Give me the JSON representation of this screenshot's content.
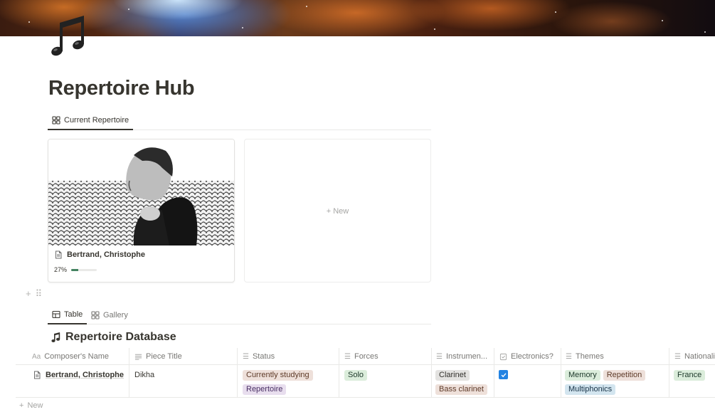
{
  "page": {
    "title": "Repertoire Hub",
    "icon": "musical-notes-icon"
  },
  "top_view": {
    "tabs": [
      {
        "label": "Current Repertoire",
        "icon": "gallery-icon",
        "active": true
      }
    ]
  },
  "gallery": {
    "cards": [
      {
        "title": "Bertrand, Christophe",
        "progress_label": "27%",
        "progress": 0.27,
        "icon": "page-icon"
      }
    ],
    "new_label": "+ New"
  },
  "database": {
    "tabs": [
      {
        "label": "Table",
        "icon": "table-icon",
        "active": true
      },
      {
        "label": "Gallery",
        "icon": "gallery-icon",
        "active": false
      }
    ],
    "title": "Repertoire Database",
    "title_icon": "musical-note-icon",
    "columns": [
      {
        "label": "Composer's Name",
        "icon": "Aa"
      },
      {
        "label": "Piece Title",
        "icon": "text-icon"
      },
      {
        "label": "Status",
        "icon": "list-icon"
      },
      {
        "label": "Forces",
        "icon": "list-icon"
      },
      {
        "label": "Instrumen...",
        "icon": "list-icon"
      },
      {
        "label": "Electronics?",
        "icon": "checkbox-icon"
      },
      {
        "label": "Themes",
        "icon": "list-icon"
      },
      {
        "label": "Nationali",
        "icon": "list-icon"
      }
    ],
    "rows": [
      {
        "composer": "Bertrand, Christophe",
        "piece": "Dikha",
        "status": [
          "Currently studying",
          "Repertoire"
        ],
        "forces": [
          "Solo"
        ],
        "instrumentation": [
          "Clarinet",
          "Bass clarinet"
        ],
        "electronics": true,
        "themes": [
          "Memory",
          "Repetition",
          "Multiphonics"
        ],
        "nationality": [
          "France"
        ]
      }
    ],
    "new_row_label": "New"
  },
  "colors": {
    "tag_brown": "#eee0da",
    "tag_purple": "#e8deee",
    "tag_green": "#dbeddb",
    "tag_gray": "#e3e2e0",
    "tag_red": "#ffe2dd",
    "tag_blue": "#d3e5ef",
    "checkbox_blue": "#2383e2",
    "progress_green": "#448361"
  }
}
